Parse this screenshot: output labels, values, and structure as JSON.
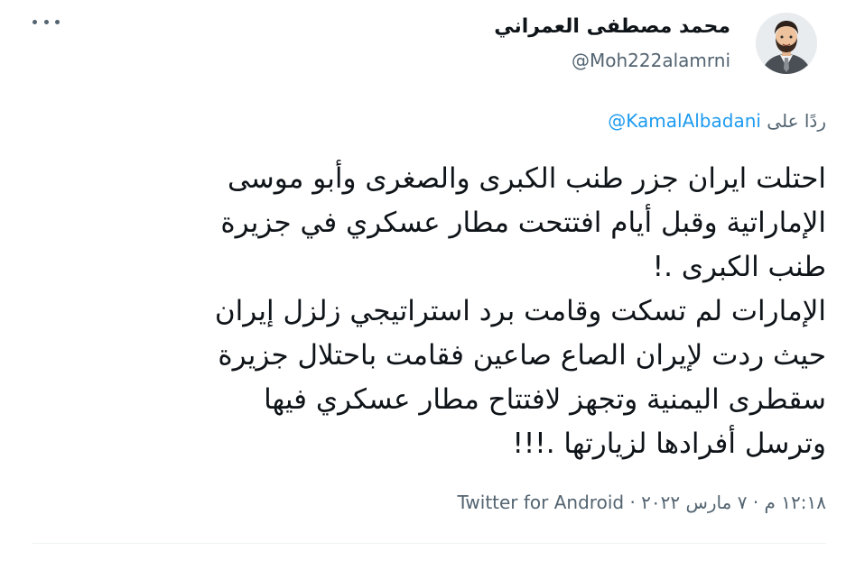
{
  "tweet": {
    "author": {
      "display_name": "محمد مصطفى العمراني",
      "handle": "@Moh222alamrni",
      "avatar_icon": "user-avatar-icon"
    },
    "more_icon": "more-horizontal-icon",
    "reply": {
      "prefix": "ردًا على",
      "mention": "@KamalAlbadani"
    },
    "text_lines": [
      "احتلت ايران جزر طنب الكبرى والصغرى وأبو موسى",
      "الإماراتية وقبل أيام افتتحت مطار عسكري في جزيرة",
      "طنب الكبرى .!",
      "الإمارات لم تسكت وقامت برد استراتيجي زلزل إيران",
      "حيث ردت لإيران الصاع صاعين فقامت باحتلال جزيرة",
      "سقطرى اليمنية وتجهز لافتتاح مطار عسكري فيها",
      "وترسل أفرادها لزيارتها .!!!"
    ],
    "timestamp": "١٢:١٨ م · ٧ مارس ٢٠٢٢",
    "separator": "·",
    "source": "Twitter for Android"
  },
  "colors": {
    "text": "#0f1419",
    "secondary": "#536471",
    "link": "#1d9bf0",
    "divider": "#eff3f4"
  }
}
